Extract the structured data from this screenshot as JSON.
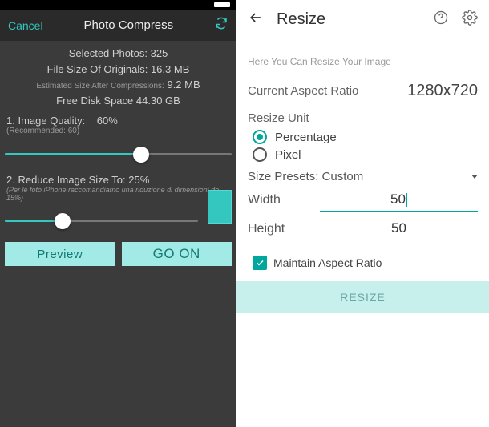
{
  "left": {
    "cancel": "Cancel",
    "title": "Photo Compress",
    "selected_label": "Selected Photos:",
    "selected_count": "325",
    "orig_label": "File Size Of Originals:",
    "orig_value": "16.3 MB",
    "est_label": "Estimated Size After Compressions:",
    "est_value": "9.2 MB",
    "free_label": "Free Disk Space",
    "free_value": "44.30 GB",
    "q_label": "1. Image Quality:",
    "q_value": "60%",
    "q_rec": "(Recommended: 60)",
    "s_label": "2. Reduce Image Size To:",
    "s_value": "25%",
    "s_hint": "(Per le foto iPhone raccomandiamo una riduzione di dimensioni del 15%)",
    "preview": "Preview",
    "go": "GO ON"
  },
  "right": {
    "title": "Resize",
    "subtitle": "Here You Can Resize Your Image",
    "aspect_label": "Current Aspect Ratio",
    "aspect_value": "1280x720",
    "unit_label": "Resize Unit",
    "radio_pct": "Percentage",
    "radio_px": "Pixel",
    "preset_label": "Size Presets:",
    "preset_value": "Custom",
    "width_label": "Width",
    "width_value": "50",
    "height_label": "Height",
    "height_value": "50",
    "maintain": "Maintain Aspect Ratio",
    "resize_btn": "RESIZE"
  }
}
